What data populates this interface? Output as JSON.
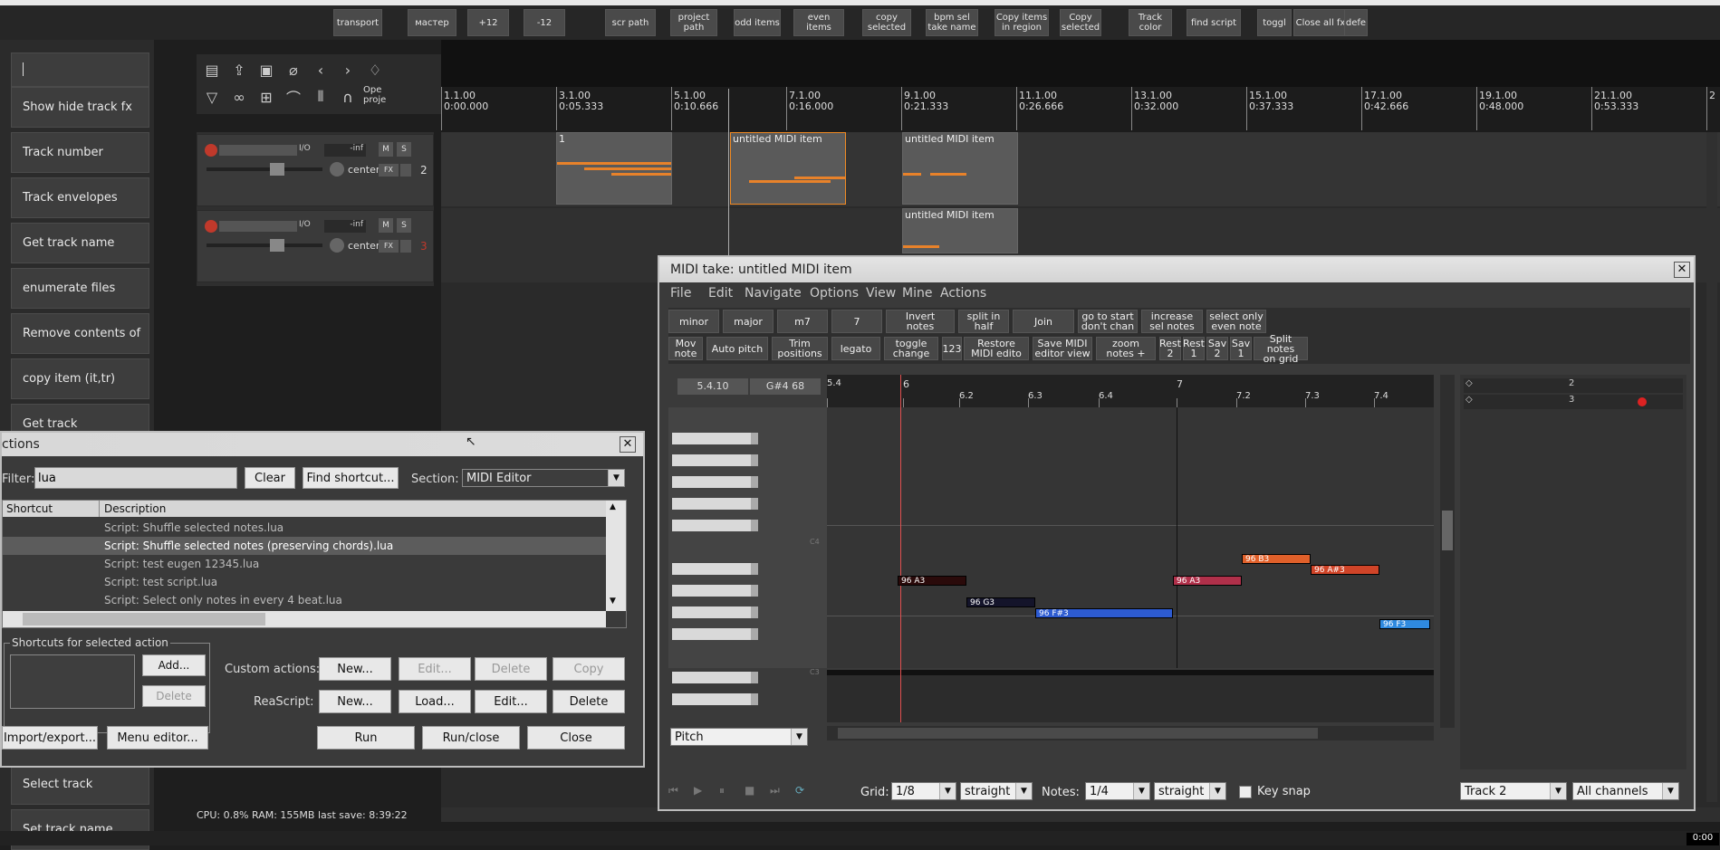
{
  "toolbar": {
    "buttons": [
      "transport",
      "мастер",
      "+12",
      "-12",
      "scr path",
      "project\npath",
      "odd items",
      "even items",
      "copy\nselected",
      "bpm sel\ntake name",
      "Copy items\nin region",
      "Copy\nselected",
      "Track\ncolor",
      "find script",
      "toggl",
      "Close all fx",
      "defe"
    ]
  },
  "left_panel": {
    "buttons": [
      "Show hide track fx",
      "Track number",
      "Track envelopes",
      "Get track name",
      "enumerate files",
      "Remove contents of",
      "copy item (it,tr)",
      "Get track",
      "Select track",
      "Set track name"
    ]
  },
  "icons_bar": {
    "last_label": "Ope\nproje"
  },
  "tracks": [
    {
      "number": "2",
      "volume": "-inf",
      "pan": "center",
      "mute": "M",
      "solo": "S",
      "io": "I/O",
      "fx": "FX"
    },
    {
      "number": "3",
      "volume": "-inf",
      "pan": "center",
      "mute": "M",
      "solo": "S",
      "io": "I/O",
      "fx": "FX"
    }
  ],
  "ruler": {
    "marks": [
      [
        "1.1.00",
        "0:00.000"
      ],
      [
        "3.1.00",
        "0:05.333"
      ],
      [
        "5.1.00",
        "0:10.666"
      ],
      [
        "7.1.00",
        "0:16.000"
      ],
      [
        "9.1.00",
        "0:21.333"
      ],
      [
        "11.1.00",
        "0:26.666"
      ],
      [
        "13.1.00",
        "0:32.000"
      ],
      [
        "15.1.00",
        "0:37.333"
      ],
      [
        "17.1.00",
        "0:42.666"
      ],
      [
        "19.1.00",
        "0:48.000"
      ],
      [
        "21.1.00",
        "0:53.333"
      ],
      [
        "2",
        ""
      ]
    ]
  },
  "items": {
    "item1": "1",
    "item2": "untitled MIDI item",
    "item3": "untitled MIDI item",
    "item4": "untitled MIDI item"
  },
  "status": {
    "text": "CPU: 0.8%  RAM: 155MB  last save: 8:39:22",
    "clock": "0:00"
  },
  "midi": {
    "title": "MIDI take: untitled MIDI item",
    "menu": [
      "File",
      "Edit",
      "Navigate",
      "Options",
      "View",
      "Mine",
      "Actions"
    ],
    "row1": [
      "minor",
      "major",
      "m7",
      "7",
      "Invert\nnotes",
      "split in half",
      "Join",
      "go to start\ndon't chan",
      "increase\nsel notes",
      "select only\neven note"
    ],
    "row2": [
      "Mov\nnote",
      "Auto pitch",
      "Trim\npositions",
      "legato",
      "toggle\nchange",
      "123",
      "Restore\nMIDI edito",
      "Save MIDI\neditor view",
      "zoom\nnotes +",
      "Rest\n2",
      "Rest\n1",
      "Sav\n2",
      "Sav\n1",
      "Split notes\non grid"
    ],
    "position": "5.4.10",
    "pitch": "G#4  68",
    "ruler": [
      "5.4",
      "6",
      "6.2",
      "6.3",
      "6.4",
      "7",
      "7.2",
      "7.3",
      "7.4"
    ],
    "notes": [
      "96 A3",
      "96 G3",
      "96 F#3",
      "96 A3",
      "96 B3",
      "96 A#3",
      "96 F3"
    ],
    "key_labels": [
      "C4",
      "C3"
    ],
    "cc_lane": "Pitch",
    "grid_label": "Grid:",
    "grid": "1/8",
    "grid_mode": "straight",
    "notes_label": "Notes:",
    "note_len": "1/4",
    "note_mode": "straight",
    "key_snap": "Key snap",
    "track_sel": "Track 2",
    "channel_sel": "All channels",
    "tracklist": [
      "2",
      "3"
    ]
  },
  "actions": {
    "title": "ctions",
    "filter_label": "Filter:",
    "filter_value": "lua",
    "clear": "Clear",
    "find_shortcut": "Find shortcut...",
    "section_label": "Section:",
    "section_value": "MIDI Editor",
    "col_shortcut": "Shortcut",
    "col_description": "Description",
    "rows": [
      "Script: Shuffle selected notes.lua",
      "Script: Shuffle selected notes (preserving chords).lua",
      "Script: test eugen 12345.lua",
      "Script: test script.lua",
      "Script: Select only notes in every 4 beat.lua"
    ],
    "shortcuts_group": "Shortcuts for selected action",
    "add": "Add...",
    "delete": "Delete",
    "custom_label": "Custom actions:",
    "new": "New...",
    "edit": "Edit...",
    "copy": "Copy",
    "reascript_label": "ReaScript:",
    "load": "Load...",
    "import_export": "Import/export...",
    "menu_editor": "Menu editor...",
    "run": "Run",
    "run_close": "Run/close",
    "close": "Close"
  }
}
